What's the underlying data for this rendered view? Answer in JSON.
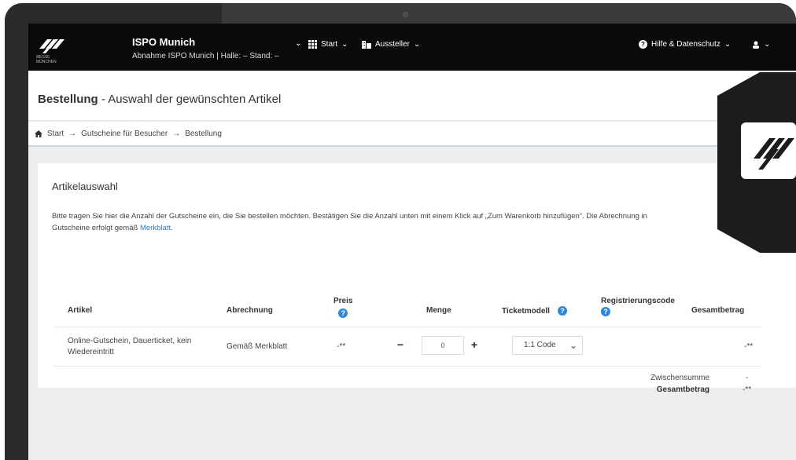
{
  "app": {
    "title": "ISPO Munich",
    "subtitle": "Abnahme ISPO Munich | Halle: – Stand: –",
    "logo_text": "MESSE MÜNCHEN"
  },
  "nav": {
    "start": "Start",
    "aussteller": "Aussteller",
    "help": "Hilfe & Datenschutz"
  },
  "page": {
    "title_bold": "Bestellung",
    "title_rest": " - Auswahl der gewünschten Artikel"
  },
  "breadcrumb": [
    "Start",
    "Gutscheine für Besucher",
    "Bestellung"
  ],
  "card": {
    "heading": "Artikelauswahl",
    "intro": "Bitte tragen Sie hier die Anzahl der Gutscheine ein, die Sie bestellen möchten. Bestätigen Sie die Anzahl unten mit einem Klick auf „Zum Warenkorb hinzufügen“. Die Abrechnung in",
    "intro2": "Gutscheine erfolgt gemäß ",
    "intro_link": "Merkblatt",
    "intro_end": "."
  },
  "table": {
    "headers": {
      "artikel": "Artikel",
      "abrechnung": "Abrechnung",
      "preis": "Preis",
      "menge": "Menge",
      "ticketmodell": "Ticketmodell",
      "registrierungscode": "Registrierungscode",
      "gesamtbetrag": "Gesamtbetrag"
    },
    "row": {
      "artikel_line1": "Online-Gutschein, Dauerticket, kein",
      "artikel_line2": "Wiedereintritt",
      "abrechnung": "Gemäß Merkblatt",
      "preis": "-**",
      "menge": "0",
      "ticketmodell": "1:1 Code",
      "gesamt": "-**"
    },
    "summary": {
      "zwischensumme_label": "Zwischensumme",
      "zwischensumme_value": "-",
      "gesamtbetrag_label": "Gesamtbetrag",
      "gesamtbetrag_value": "-**"
    }
  },
  "icons": {
    "help": "?",
    "minus": "−",
    "plus": "+",
    "arrow": "→"
  }
}
